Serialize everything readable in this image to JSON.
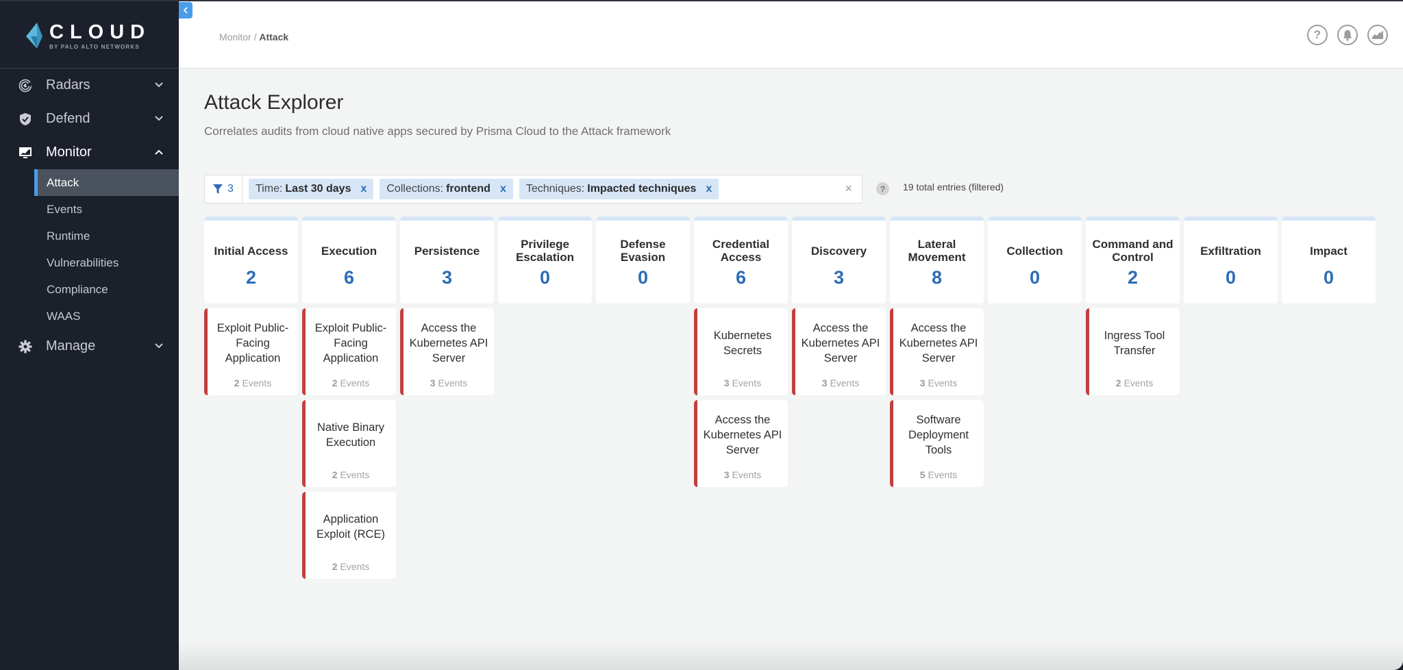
{
  "brand": {
    "name": "CLOUD",
    "sub": "BY PALO ALTO NETWORKS",
    "accent": "#4a9de8",
    "logo_icon": "prisma-logo-icon"
  },
  "sidebar": {
    "items": [
      {
        "label": "Radars",
        "icon": "radar-icon",
        "expanded": false
      },
      {
        "label": "Defend",
        "icon": "shield-check-icon",
        "expanded": false
      },
      {
        "label": "Monitor",
        "icon": "monitor-chart-icon",
        "expanded": true,
        "children": [
          {
            "label": "Attack",
            "active": true
          },
          {
            "label": "Events"
          },
          {
            "label": "Runtime"
          },
          {
            "label": "Vulnerabilities"
          },
          {
            "label": "Compliance"
          },
          {
            "label": "WAAS"
          }
        ]
      },
      {
        "label": "Manage",
        "icon": "gear-icon",
        "expanded": false
      }
    ]
  },
  "header": {
    "breadcrumb": {
      "parent": "Monitor",
      "separator": " / ",
      "current": "Attack"
    },
    "icons": [
      "help-icon",
      "bell-icon",
      "chart-icon"
    ]
  },
  "page": {
    "title": "Attack Explorer",
    "description": "Correlates audits from cloud native apps secured by Prisma Cloud to the Attack framework"
  },
  "filters": {
    "count": "3",
    "chips": [
      {
        "key": "Time:",
        "value": "Last 30 days",
        "remove": "x"
      },
      {
        "key": "Collections:",
        "value": "frontend",
        "remove": "x"
      },
      {
        "key": "Techniques:",
        "value": "Impacted techniques",
        "remove": "x"
      }
    ],
    "clear": "×",
    "help": "?",
    "total": "19 total entries (filtered)"
  },
  "colors": {
    "count_blue": "#2e6db6",
    "technique_bar": "#c0403f",
    "chip_bg": "#d6e6f7"
  },
  "tactics": [
    {
      "name": "Initial Access",
      "count": "2",
      "techniques": [
        {
          "name": "Exploit Public-Facing Application",
          "events": "2",
          "events_label": "Events"
        }
      ]
    },
    {
      "name": "Execution",
      "count": "6",
      "techniques": [
        {
          "name": "Exploit Public-Facing Application",
          "events": "2",
          "events_label": "Events"
        },
        {
          "name": "Native Binary Execution",
          "events": "2",
          "events_label": "Events"
        },
        {
          "name": "Application Exploit (RCE)",
          "events": "2",
          "events_label": "Events"
        }
      ]
    },
    {
      "name": "Persistence",
      "count": "3",
      "techniques": [
        {
          "name": "Access the Kubernetes API Server",
          "events": "3",
          "events_label": "Events"
        }
      ]
    },
    {
      "name": "Privilege Escalation",
      "count": "0",
      "techniques": []
    },
    {
      "name": "Defense Evasion",
      "count": "0",
      "techniques": []
    },
    {
      "name": "Credential Access",
      "count": "6",
      "techniques": [
        {
          "name": "Kubernetes Secrets",
          "events": "3",
          "events_label": "Events"
        },
        {
          "name": "Access the Kubernetes API Server",
          "events": "3",
          "events_label": "Events"
        }
      ]
    },
    {
      "name": "Discovery",
      "count": "3",
      "techniques": [
        {
          "name": "Access the Kubernetes API Server",
          "events": "3",
          "events_label": "Events"
        }
      ]
    },
    {
      "name": "Lateral Movement",
      "count": "8",
      "techniques": [
        {
          "name": "Access the Kubernetes API Server",
          "events": "3",
          "events_label": "Events"
        },
        {
          "name": "Software Deployment Tools",
          "events": "5",
          "events_label": "Events"
        }
      ]
    },
    {
      "name": "Collection",
      "count": "0",
      "techniques": []
    },
    {
      "name": "Command and Control",
      "count": "2",
      "techniques": [
        {
          "name": "Ingress Tool Transfer",
          "events": "2",
          "events_label": "Events"
        }
      ]
    },
    {
      "name": "Exfiltration",
      "count": "0",
      "techniques": []
    },
    {
      "name": "Impact",
      "count": "0",
      "techniques": []
    }
  ]
}
